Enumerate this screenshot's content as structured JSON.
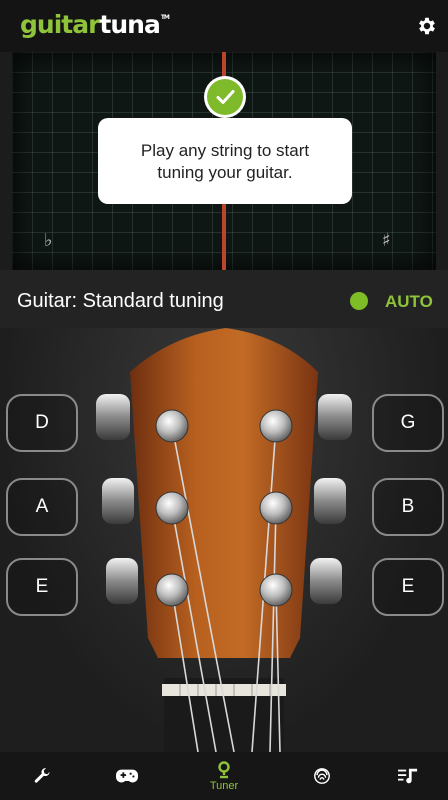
{
  "header": {
    "logo_part1": "guitar",
    "logo_part2": "tuna",
    "logo_tm": "TM",
    "settings_icon": "gear-icon"
  },
  "meter": {
    "tooltip_text": "Play any string to start tuning your guitar.",
    "flat_symbol": "♭",
    "sharp_symbol": "♯",
    "check_icon": "checkmark-icon"
  },
  "tuning": {
    "title": "Guitar: Standard tuning",
    "auto_label": "AUTO",
    "auto_color": "#7fbd27"
  },
  "strings": {
    "left": [
      "D",
      "A",
      "E"
    ],
    "right": [
      "G",
      "B",
      "E"
    ]
  },
  "nav": {
    "items": [
      {
        "icon": "wrench-icon",
        "label": ""
      },
      {
        "icon": "gamepad-icon",
        "label": ""
      },
      {
        "icon": "tuner-icon",
        "label": "Tuner"
      },
      {
        "icon": "fingerprint-icon",
        "label": ""
      },
      {
        "icon": "music-list-icon",
        "label": ""
      }
    ]
  },
  "colors": {
    "accent": "#8fc33a",
    "needle": "#b8452c"
  }
}
